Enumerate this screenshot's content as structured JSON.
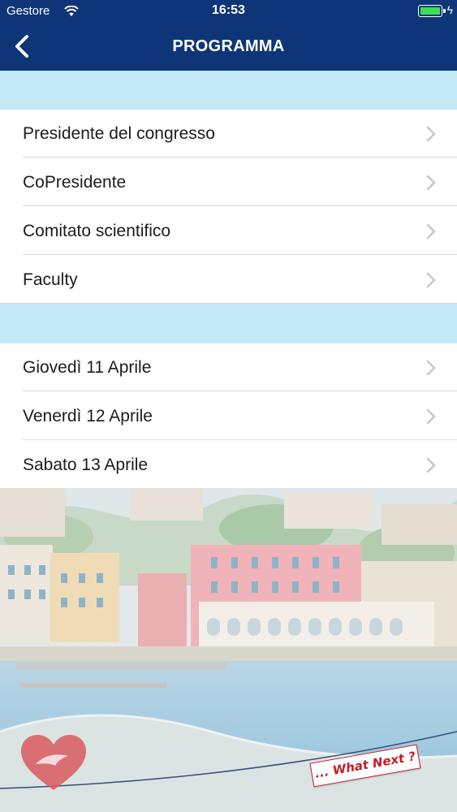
{
  "status": {
    "carrier": "Gestore",
    "time": "16:53",
    "battery_level": 1.0
  },
  "nav": {
    "title": "PROGRAMMA"
  },
  "section1": {
    "items": [
      {
        "label": "Presidente del congresso"
      },
      {
        "label": "CoPresidente"
      },
      {
        "label": "Comitato scientifico"
      },
      {
        "label": "Faculty"
      }
    ]
  },
  "section2": {
    "items": [
      {
        "label": "Giovedì 11 Aprile"
      },
      {
        "label": "Venerdì 12 Aprile"
      },
      {
        "label": "Sabato 13 Aprile"
      }
    ]
  },
  "footer": {
    "badge_text": "... What Next ?"
  },
  "colors": {
    "navbar": "#0e3577",
    "section_header": "#c5e8f7",
    "battery": "#3adf54",
    "badge": "#c0202a"
  }
}
